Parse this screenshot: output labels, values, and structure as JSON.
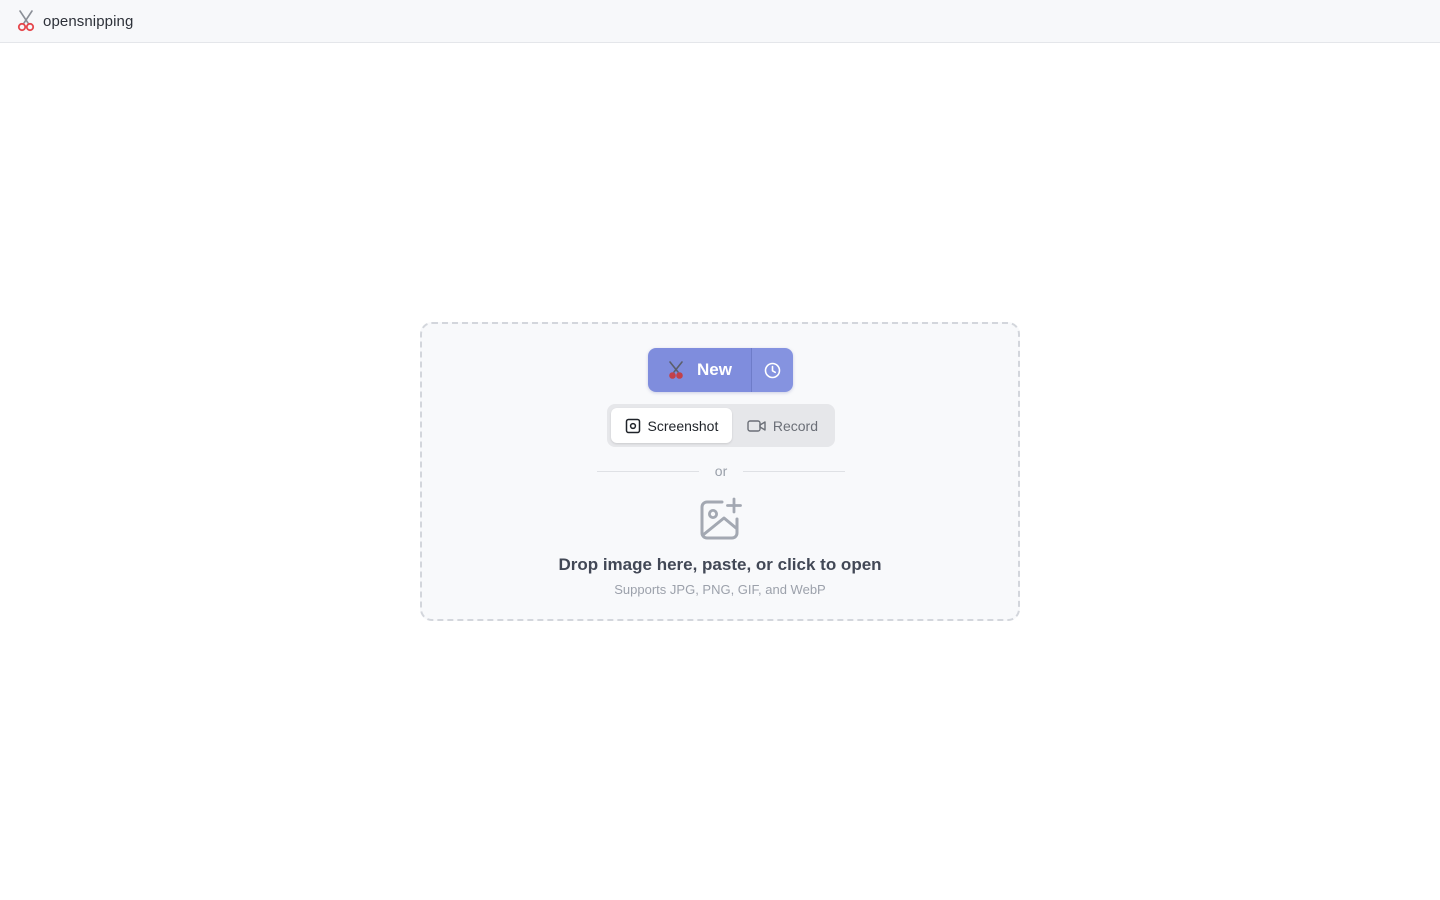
{
  "app": {
    "title": "opensnipping",
    "logo_icon": "scissors-icon"
  },
  "toolbar": {
    "new_label": "New",
    "new_icon": "scissors-icon",
    "history_icon": "clock-icon"
  },
  "mode": {
    "options": [
      {
        "label": "Screenshot",
        "icon": "screenshot-icon",
        "active": true
      },
      {
        "label": "Record",
        "icon": "video-camera-icon",
        "active": false
      }
    ]
  },
  "divider": {
    "text": "or"
  },
  "dropzone": {
    "icon": "image-plus-icon",
    "title": "Drop image here, paste, or click to open",
    "subtitle": "Supports JPG, PNG, GIF, and WebP"
  },
  "colors": {
    "accent": "#7f8ddd",
    "accent_secondary": "#8593e0",
    "logo_red": "#e5484d",
    "muted_text": "#9ca1ab"
  }
}
